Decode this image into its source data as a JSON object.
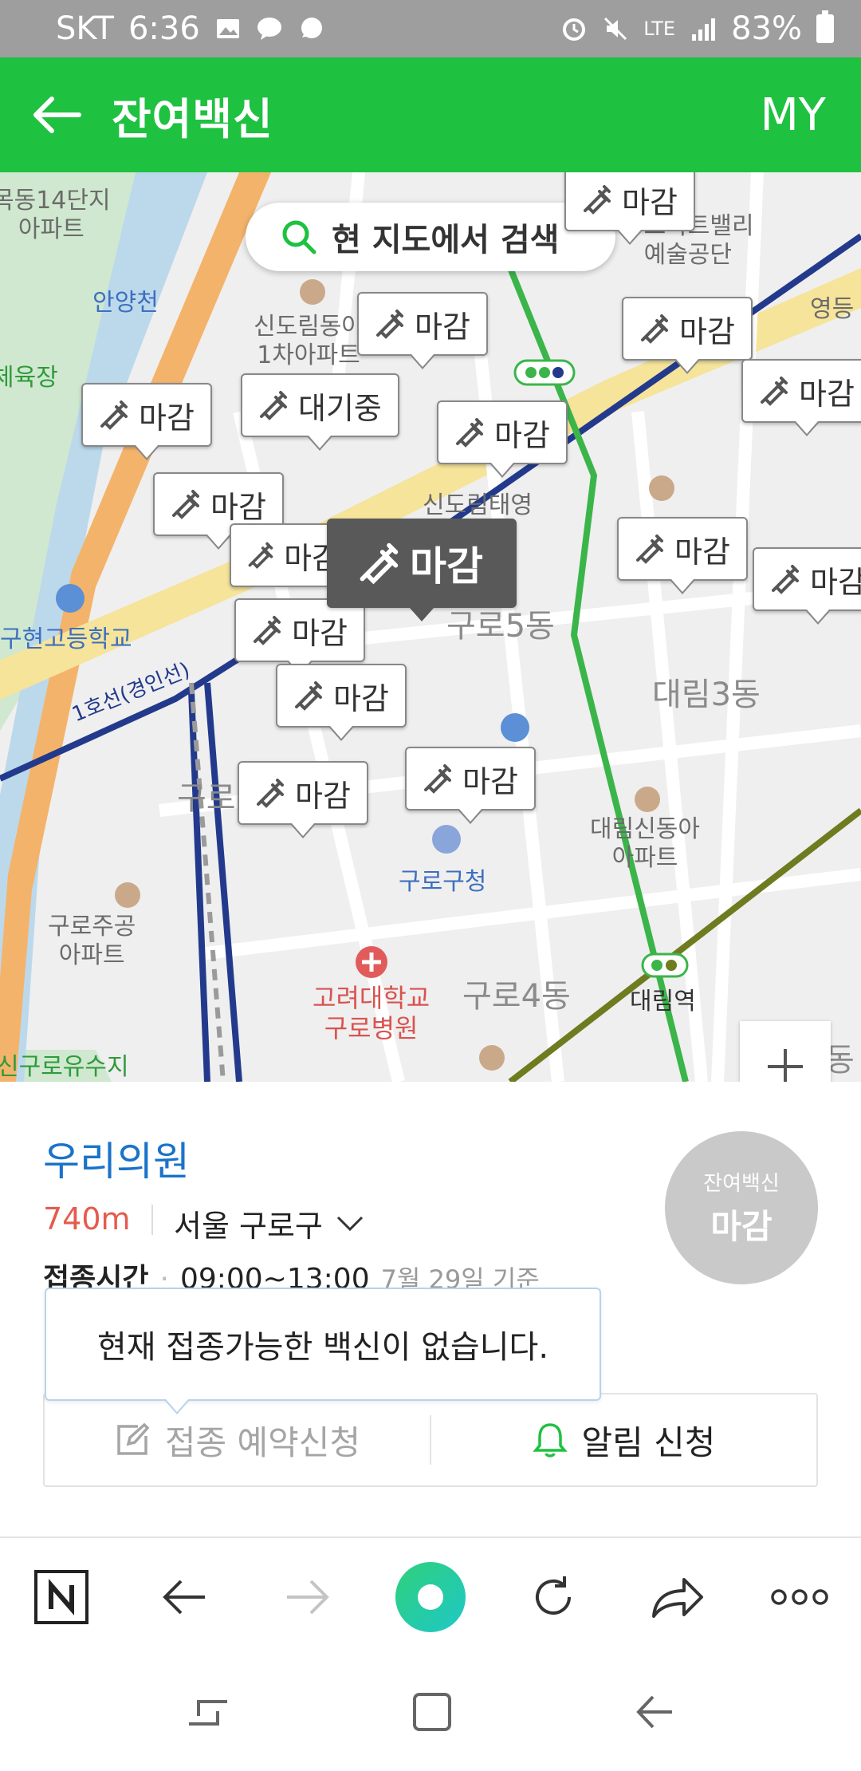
{
  "status_bar": {
    "carrier": "SKT",
    "time": "6:36",
    "network": "LTE",
    "battery": "83%"
  },
  "app_bar": {
    "title": "잔여백신",
    "my_label": "MY"
  },
  "map": {
    "search_label": "현 지도에서 검색",
    "labels": {
      "mokdong": "목동14단지\n아파트",
      "anyangcheon": "안양천",
      "sindorim_apt": "신도림동아\n1차아파트",
      "sindorim_taeyoung": "신도림태영\n아파트",
      "line1": "1호선(경인선)",
      "guhyeon_school": "구현고등학교",
      "gurodong5": "구로5동",
      "daerim3": "대림3동",
      "daerim_shindonga": "대림신동아\n아파트",
      "guro_office": "구로구청",
      "gurojugong": "구로주공\n아파트",
      "guro4": "구로4동",
      "daerim_station": "대림역",
      "korea_univ": "고려대학교\n구로병원",
      "singuro_reservoir": "신구로유수지",
      "daerim2": "대림2동",
      "art_center": "구로아트밸리\n예술공단",
      "yeongdeungpo": "영등",
      "gym": "체육장",
      "guro": "구로"
    },
    "markers": [
      {
        "label": "마감"
      },
      {
        "label": "마감"
      },
      {
        "label": "마감"
      },
      {
        "label": "대기중"
      },
      {
        "label": "마감"
      },
      {
        "label": "마감"
      },
      {
        "label": "마감"
      },
      {
        "label": "마감"
      },
      {
        "label": "마감"
      },
      {
        "label": "마감"
      },
      {
        "label": "마감"
      },
      {
        "label": "마감"
      },
      {
        "label": "마감"
      },
      {
        "label": "마감"
      },
      {
        "label": "마감"
      }
    ],
    "selected_marker": "마감"
  },
  "detail": {
    "name": "우리의원",
    "distance": "740m",
    "region": "서울 구로구",
    "hours_label": "접종시간",
    "hours_value": "09:00~13:00",
    "hours_basis": "7월 29일 기준",
    "badge_top": "잔여백신",
    "badge_bottom": "마감",
    "tooltip": "현재 접종가능한 백신이 없습니다.",
    "reserve_label": "접종 예약신청",
    "notify_label": "알림 신청"
  },
  "colors": {
    "brand_green": "#1ec140",
    "link_blue": "#1a73c9",
    "distance_red": "#e55b4d"
  }
}
